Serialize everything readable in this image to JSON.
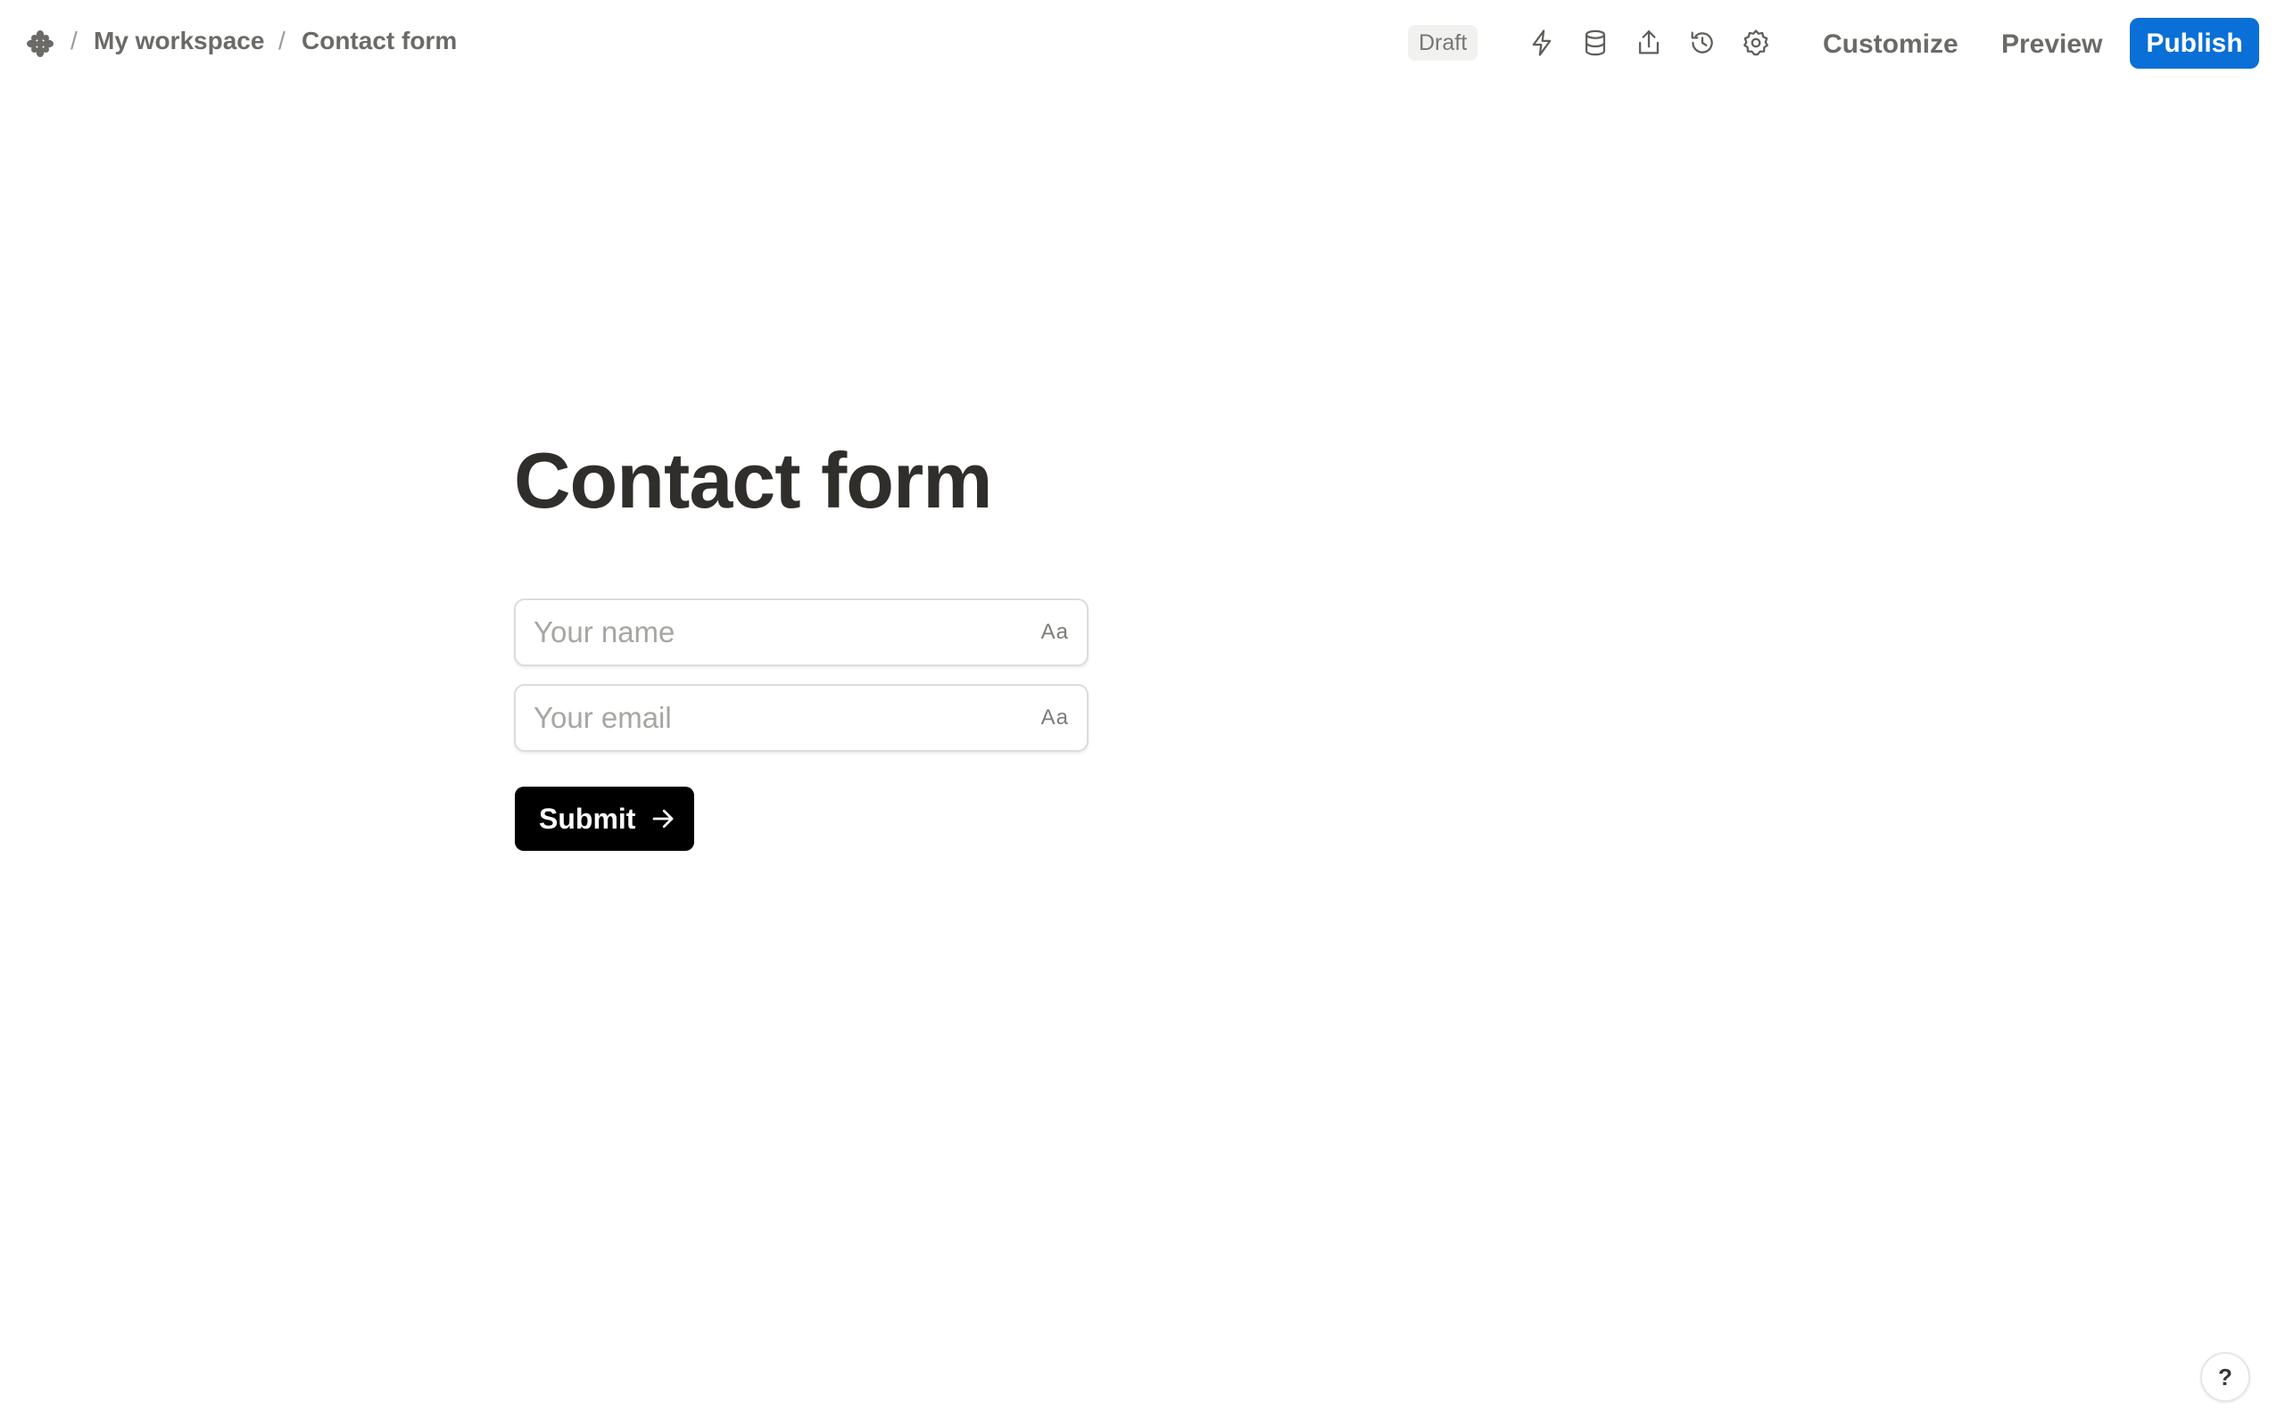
{
  "breadcrumb": {
    "separator": "/",
    "workspace": "My workspace",
    "page": "Contact form"
  },
  "toolbar": {
    "status_badge": "Draft",
    "icons": [
      "lightning-icon",
      "database-icon",
      "share-icon",
      "history-icon",
      "settings-icon"
    ],
    "customize_label": "Customize",
    "preview_label": "Preview",
    "publish_label": "Publish"
  },
  "form": {
    "title": "Contact form",
    "fields": [
      {
        "placeholder": "Your name",
        "value": "",
        "type_icon": "Aa"
      },
      {
        "placeholder": "Your email",
        "value": "",
        "type_icon": "Aa"
      }
    ],
    "submit_label": "Submit"
  },
  "help": {
    "label": "?"
  },
  "colors": {
    "publish_bg": "#0a6fd6",
    "submit_bg": "#000000",
    "title_text": "#2f2e2b",
    "muted_text": "#6b6a66"
  }
}
